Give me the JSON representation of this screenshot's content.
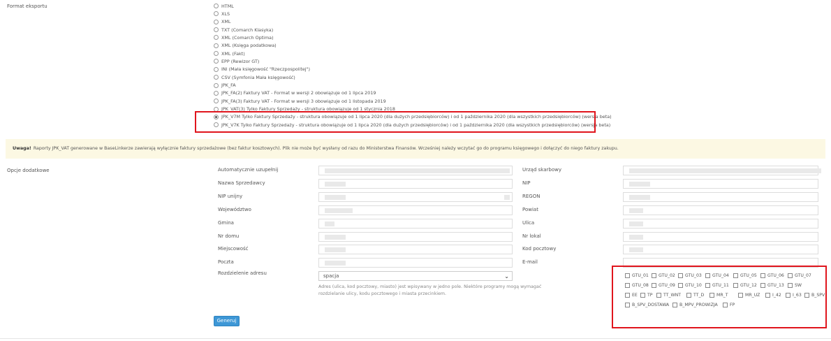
{
  "section_export": {
    "label": "Format eksportu"
  },
  "formats": [
    {
      "label": "HTML",
      "checked": false
    },
    {
      "label": "XLS",
      "checked": false
    },
    {
      "label": "XML",
      "checked": false
    },
    {
      "label": "TXT (Comarch Klasyka)",
      "checked": false
    },
    {
      "label": "XML (Comarch Optima)",
      "checked": false
    },
    {
      "label": "XML (Księga podatkowa)",
      "checked": false
    },
    {
      "label": "XML (Fakt)",
      "checked": false
    },
    {
      "label": "EPP (Rewizor GT)",
      "checked": false
    },
    {
      "label": "INI (Mała księgowość \"Rzeczpospolitej\")",
      "checked": false
    },
    {
      "label": "CSV (Symfonia Mała księgowość)",
      "checked": false
    },
    {
      "label": "JPK_FA",
      "checked": false
    },
    {
      "label": "JPK_FA(2) Faktury VAT - Format w wersji 2 obowiązuje od 1 lipca 2019",
      "checked": false
    },
    {
      "label": "JPK_FA(3) Faktury VAT - Format w wersji 3 obowiązuje od 1 listopada 2019",
      "checked": false
    },
    {
      "label": "JPK_VAT(3) Tylko Faktury Sprzedaży - struktura obowiązuje od 1 stycznia 2018",
      "checked": false
    },
    {
      "label": "JPK_V7M Tylko Faktury Sprzedaży - struktura obowiązuje od 1 lipca 2020 (dla dużych przedsiębiorców) i od 1 października 2020 (dla wszystkich przedsiębiorców) (wersja beta)",
      "checked": true
    },
    {
      "label": "JPK_V7K Tylko Faktury Sprzedaży - struktura obowiązuje od 1 lipca 2020 (dla dużych przedsiębiorców) i od 1 października 2020 (dla wszystkich przedsiębiorców) (wersja beta)",
      "checked": false
    }
  ],
  "notice": {
    "title": "Uwaga!",
    "text": "Raporty JPK_VAT generowane w BaseLinkerze zawierają wyłącznie faktury sprzedażowe (bez faktur kosztowych). Plik nie może być wysłany od razu do Ministerstwa Finansów. Wcześniej należy wczytać go do programu księgowego i dołączyć do niego faktury zakupu."
  },
  "section_options": {
    "label": "Opcje dodatkowe"
  },
  "left_fields": [
    {
      "label": "Automatycznie uzupełnij"
    },
    {
      "label": "Nazwa Sprzedawcy"
    },
    {
      "label": "NIP unijny"
    },
    {
      "label": "Województwo"
    },
    {
      "label": "Gmina"
    },
    {
      "label": "Nr domu"
    },
    {
      "label": "Miejscowość"
    },
    {
      "label": "Poczta"
    }
  ],
  "right_fields": [
    {
      "label": "Urząd skarbowy"
    },
    {
      "label": "NIP"
    },
    {
      "label": "REGON"
    },
    {
      "label": "Powiat"
    },
    {
      "label": "Ulica"
    },
    {
      "label": "Nr lokal"
    },
    {
      "label": "Kod pocztowy"
    },
    {
      "label": "E-mail"
    }
  ],
  "address_split": {
    "label": "Rozdzielenie adresu",
    "selected": "spacja",
    "help": "Adres (ulica, kod pocztowy, miasto) jest wpisywany w jedno pole. Niektóre programy mogą wymagać rozdzielanie ulicy, kodu pocztowego i miasta przecinkiem."
  },
  "gtu_rows": [
    [
      "GTU_01",
      "GTU_02",
      "GTU_03",
      "GTU_04",
      "GTU_05",
      "GTU_06",
      "GTU_07"
    ],
    [
      "GTU_08",
      "GTU_09",
      "GTU_10",
      "GTU_11",
      "GTU_12",
      "GTU_13",
      "SW"
    ],
    [
      "EE",
      "TP",
      "TT_WNT",
      "TT_D",
      "MR_T",
      "MR_UZ",
      "I_42",
      "I_63",
      "B_SPV"
    ],
    [
      "B_SPV_DOSTAWA",
      "B_MPV_PROWIZJA",
      "FP"
    ]
  ],
  "generate_button": {
    "label": "Generuj"
  },
  "colors": {
    "highlight": "#e0151d",
    "notice_bg": "#fcf8e3",
    "button": "#3d97d6"
  }
}
